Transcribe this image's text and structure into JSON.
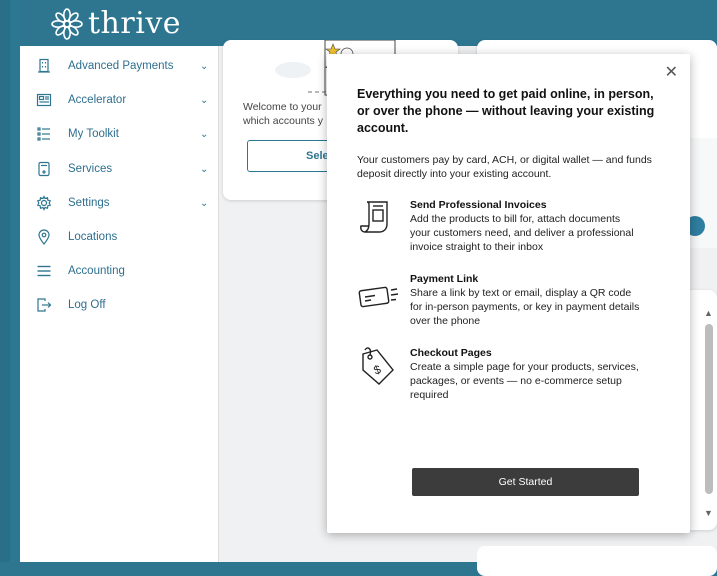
{
  "app": {
    "brand": "thrive"
  },
  "sidebar": {
    "items": [
      {
        "label": "Advanced Payments",
        "icon": "building-icon",
        "expandable": true
      },
      {
        "label": "Accelerator",
        "icon": "dashboard-icon",
        "expandable": true
      },
      {
        "label": "My Toolkit",
        "icon": "list-icon",
        "expandable": true
      },
      {
        "label": "Services",
        "icon": "device-icon",
        "expandable": true
      },
      {
        "label": "Settings",
        "icon": "gear-icon",
        "expandable": true
      },
      {
        "label": "Locations",
        "icon": "location-pin-icon",
        "expandable": false
      },
      {
        "label": "Accounting",
        "icon": "menu-lines-icon",
        "expandable": false
      },
      {
        "label": "Log Off",
        "icon": "logout-icon",
        "expandable": false
      }
    ]
  },
  "background_card": {
    "welcome_text": "Welcome to your",
    "welcome_text2": "which accounts y",
    "select_label": "Sele"
  },
  "modal": {
    "headline": "Everything you need to get paid online, in person, or over the phone — without leaving your existing account.",
    "intro": "Your customers pay by card, ACH, or digital wallet — and funds deposit directly into your existing account.",
    "features": [
      {
        "title": "Send Professional Invoices",
        "description": "Add the products to bill for, attach documents your customers need, and deliver a professional invoice straight to their inbox",
        "icon": "invoice-icon"
      },
      {
        "title": "Payment Link",
        "description": "Share a link by text or email, display a QR code for in-person payments, or key in payment details over the phone",
        "icon": "payment-link-icon"
      },
      {
        "title": "Checkout Pages",
        "description": "Create a simple page for your products, services, packages, or events — no e-commerce setup required",
        "icon": "price-tag-icon"
      }
    ],
    "cta_label": "Get Started",
    "close_glyph": "✕"
  },
  "colors": {
    "brand": "#2e7690",
    "sidebar_text": "#2e6f8e",
    "cta_bg": "#3c3c3c"
  }
}
